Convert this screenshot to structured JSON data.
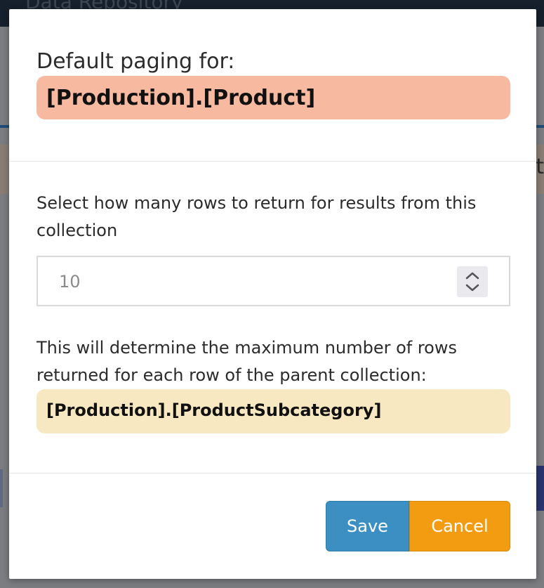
{
  "background": {
    "app_title": "Data Repository",
    "banner_fragment": "ct"
  },
  "modal": {
    "header_label": "Default paging for:",
    "collection": "[Production].[Product]",
    "prompt": "Select how many rows to return for results from this collection",
    "rows_value": "10",
    "note": "This will determine the maximum number of rows returned for each row of the parent collection:",
    "parent_collection": "[Production].[ProductSubcategory]",
    "save_label": "Save",
    "cancel_label": "Cancel"
  },
  "icons": {
    "stepper": "chevron-up-down-icon"
  },
  "colors": {
    "collection_badge": "#f7b9a0",
    "parent_badge": "#f8e8c2",
    "save": "#3b8fc2",
    "cancel": "#f39c12"
  }
}
